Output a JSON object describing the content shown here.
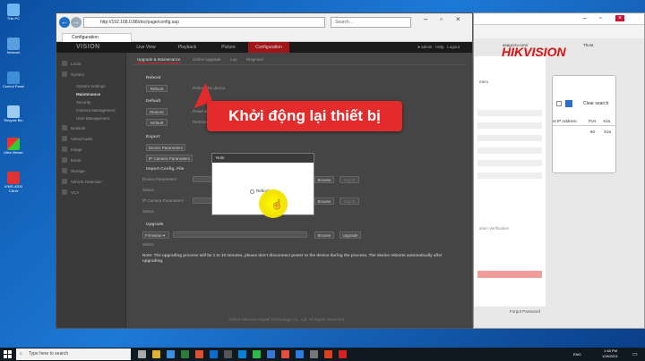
{
  "desktop": {
    "icons": [
      "This PC",
      "Network",
      "Control Panel",
      "Recycle Bin",
      "Ultra Viewer",
      "iVMS-4200 Client"
    ]
  },
  "browser": {
    "url": "http://192.168.0.88/doc/page/config.asp",
    "search_placeholder": "Search...",
    "tab_title": "Configuration"
  },
  "app": {
    "brand": "VISION",
    "nav": [
      "Live View",
      "Playback",
      "Picture",
      "Configuration"
    ],
    "user": "admin",
    "help": "Help",
    "logout": "Logout",
    "sidebar": [
      {
        "label": "Local",
        "sub": false
      },
      {
        "label": "System",
        "sub": false
      },
      {
        "label": "System Settings",
        "sub": true
      },
      {
        "label": "Maintenance",
        "sub": true,
        "active": true
      },
      {
        "label": "Security",
        "sub": true
      },
      {
        "label": "Camera Management",
        "sub": true
      },
      {
        "label": "User Management",
        "sub": true
      },
      {
        "label": "Network",
        "sub": false
      },
      {
        "label": "Video/Audio",
        "sub": false
      },
      {
        "label": "Image",
        "sub": false
      },
      {
        "label": "Event",
        "sub": false
      },
      {
        "label": "Storage",
        "sub": false
      },
      {
        "label": "Vehicle Detection",
        "sub": false
      },
      {
        "label": "VCA",
        "sub": false
      }
    ],
    "subtabs": [
      "Upgrade & Maintenance",
      "Online Upgrade",
      "Log",
      "Diagnose"
    ],
    "reboot_title": "Reboot",
    "reboot_btn": "Reboot",
    "reboot_desc": "Reboot the device.",
    "default_title": "Default",
    "restore_btn": "Restore",
    "restore_desc": "Reset all",
    "default_btn": "Default",
    "default_desc": "Restore",
    "export_title": "Export",
    "export_device": "Device Parameters",
    "export_ipc": "IP Camera Parameters",
    "import_title": "Import Config. File",
    "device_params_label": "Device Parameters",
    "status_label": "Status",
    "ipc_params_label": "IP Camera Parameters",
    "status2_label": "Status",
    "browse": "Browse",
    "import": "Import",
    "upgrade_title": "Upgrade",
    "firmware_select": "Firmware",
    "upgrade_btn": "Upgrade",
    "upgrade_status_label": "Status",
    "note": "Note: The upgrading process will be 1 to 10 minutes, please don't disconnect power to the device during the process. The device reboots automatically after upgrading.",
    "footer": "©2019 Hikvision Digital Technology Co., Ltd. All Rights Reserved."
  },
  "dialog": {
    "title": "Note",
    "message": "Rebooting..."
  },
  "callout": {
    "text": "Khởi động lại thiết bị"
  },
  "backwindow": {
    "brand_main": "HIKVISION",
    "text_meters": "eters",
    "link": "asagcctv.com/",
    "link2": "Thost",
    "clear": "Clear search",
    "col_ip": "et IP Address",
    "col_port": "Port",
    "col_del": "Xóa",
    "row_port": "80",
    "row_del": "Xóa",
    "verification": "ation Verification",
    "forgot": "Forgot Password"
  },
  "taskbar": {
    "search": "Type here to search",
    "lang": "ENG",
    "time": "1:48 PM",
    "date": "1/26/2021"
  }
}
